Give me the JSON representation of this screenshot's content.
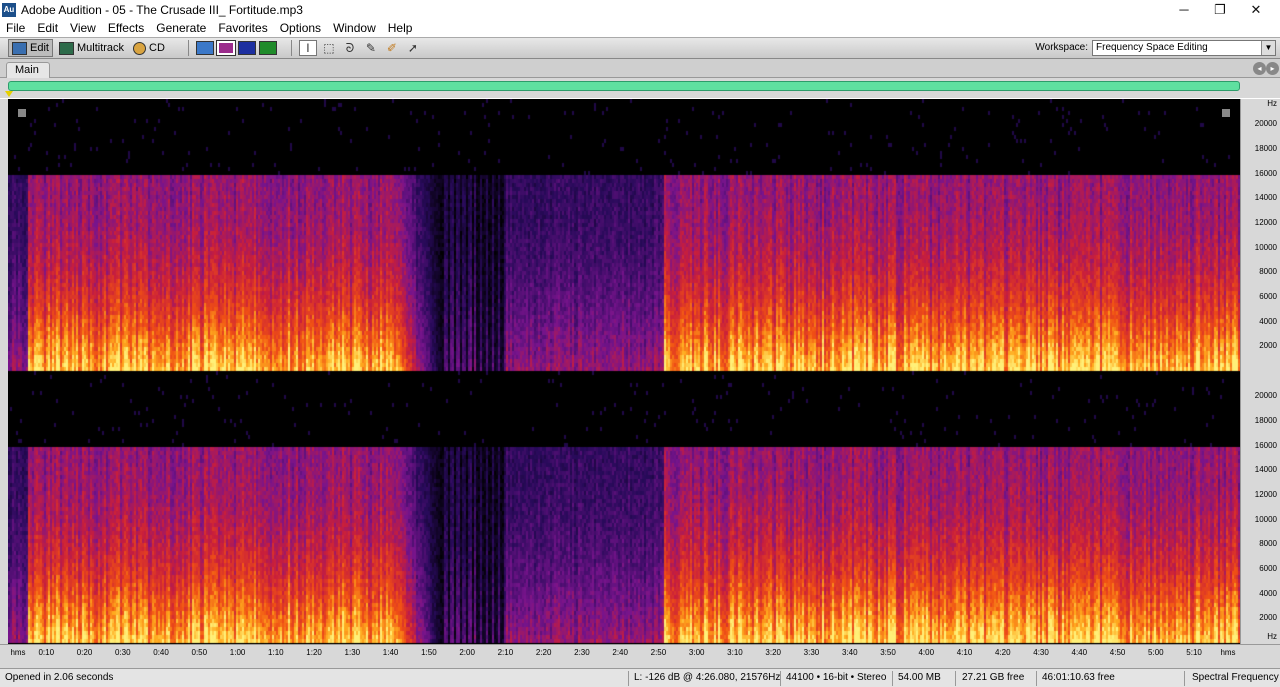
{
  "window": {
    "icon_text": "Au",
    "title": "Adobe Audition - 05 - The Crusade III_ Fortitude.mp3",
    "minimize": "─",
    "maximize": "❐",
    "close": "✕"
  },
  "menu": [
    "File",
    "Edit",
    "View",
    "Effects",
    "Generate",
    "Favorites",
    "Options",
    "Window",
    "Help"
  ],
  "toolbar": {
    "edit_label": "Edit",
    "multitrack_label": "Multitrack",
    "cd_label": "CD",
    "workspace_label": "Workspace:",
    "workspace_value": "Frequency Space Editing"
  },
  "panel": {
    "tab_label": "Main"
  },
  "rulers": {
    "freq_unit": "Hz",
    "freq_top": [
      "20000",
      "18000",
      "16000",
      "14000",
      "12000",
      "10000",
      "8000",
      "6000",
      "4000",
      "2000"
    ],
    "freq_bottom": [
      "20000",
      "18000",
      "16000",
      "14000",
      "12000",
      "10000",
      "8000",
      "6000",
      "4000",
      "2000"
    ],
    "time_unit": "hms",
    "time_ticks": [
      "0:10",
      "0:20",
      "0:30",
      "0:40",
      "0:50",
      "1:00",
      "1:10",
      "1:20",
      "1:30",
      "1:40",
      "1:50",
      "2:00",
      "2:10",
      "2:20",
      "2:30",
      "2:40",
      "2:50",
      "3:00",
      "3:10",
      "3:20",
      "3:30",
      "3:40",
      "3:50",
      "4:00",
      "4:10",
      "4:20",
      "4:30",
      "4:40",
      "4:50",
      "5:00",
      "5:10"
    ]
  },
  "audio": {
    "duration_seconds": 322,
    "max_freq_hz": 22050,
    "cutoff_freq_hz": 16000
  },
  "status": {
    "message": "Opened in 2.06 seconds",
    "cursor": "L: -126 dB @   4:26.080, 21576Hz",
    "format": "44100 • 16-bit • Stereo",
    "size": "54.00 MB",
    "free_space": "27.21 GB free",
    "free_time": "46:01:10.63 free",
    "view_mode": "Spectral Frequency"
  }
}
